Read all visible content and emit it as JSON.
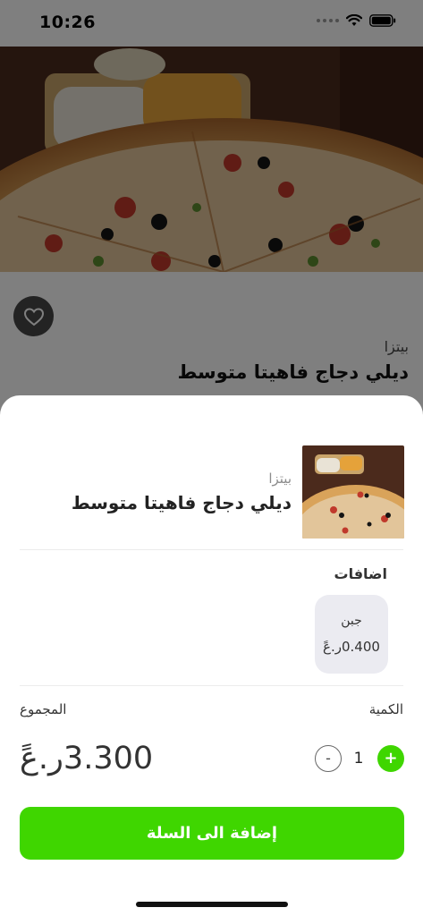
{
  "status_bar": {
    "time": "10:26"
  },
  "background_product": {
    "category": "بيتزا",
    "title": "ديلي دجاج فاهيتا متوسط"
  },
  "sheet": {
    "category": "بيتزا",
    "title": "ديلي دجاج فاهيتا متوسط",
    "extras_label": "اضافات",
    "extras": [
      {
        "name": "جبن",
        "price": "0.400ر.عً"
      }
    ],
    "quantity_label": "الكمية",
    "quantity": "1",
    "minus_symbol": "-",
    "plus_symbol": "+",
    "total_label": "المجموع",
    "total_value": "3.300ر.عً",
    "add_button_label": "إضافة الى السلة"
  },
  "colors": {
    "accent": "#3fd600",
    "chip_bg": "#ebebf1",
    "overlay": "rgba(0,0,0,0.5)"
  },
  "icons": [
    "heart-icon",
    "wifi-icon",
    "battery-icon",
    "cellular-signal-icon"
  ]
}
